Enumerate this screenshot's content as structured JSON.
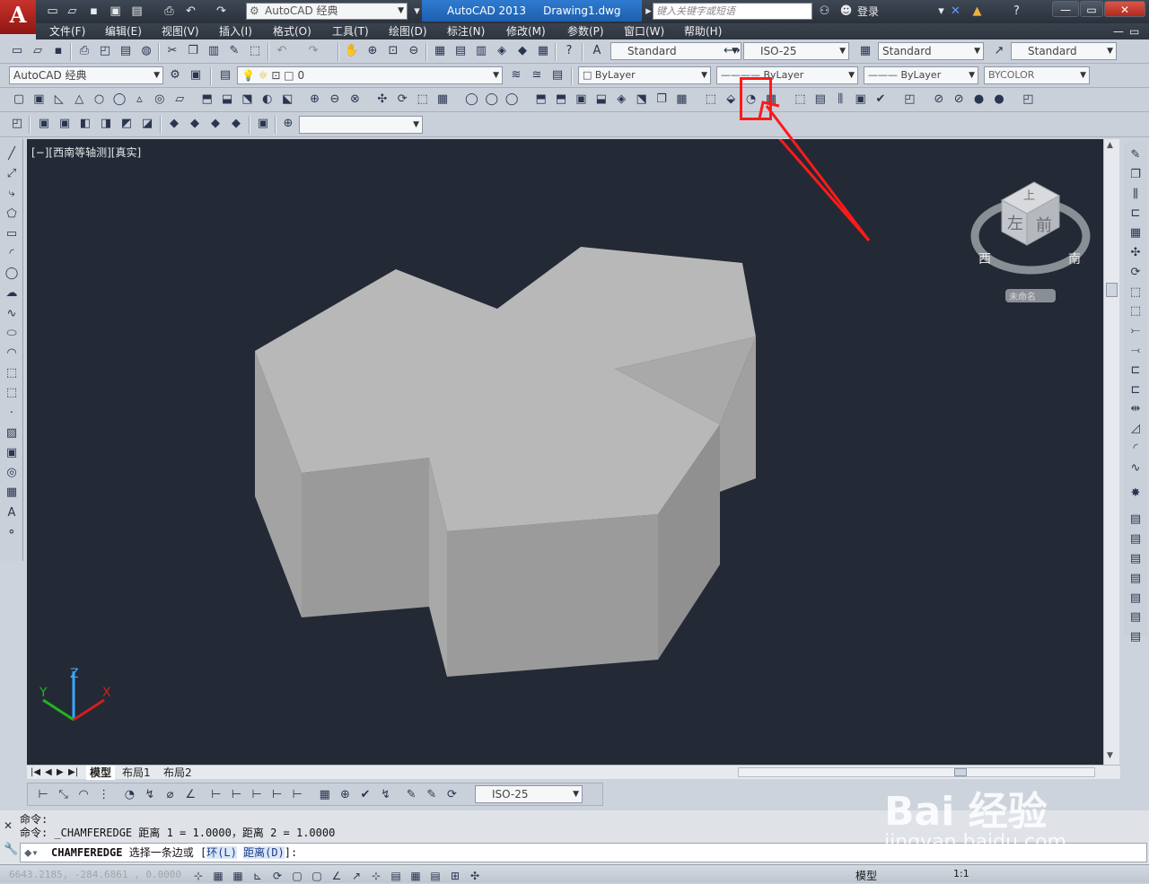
{
  "title_bar": {
    "logo": "A",
    "workspace": "AutoCAD 经典",
    "app_name": "AutoCAD 2013",
    "doc_name": "Drawing1.dwg",
    "search_placeholder": "键入关键字或短语",
    "login_label": "登录",
    "minimize": "—",
    "restore": "▭",
    "close": "✕"
  },
  "menu": [
    "文件(F)",
    "编辑(E)",
    "视图(V)",
    "插入(I)",
    "格式(O)",
    "工具(T)",
    "绘图(D)",
    "标注(N)",
    "修改(M)",
    "参数(P)",
    "窗口(W)",
    "帮助(H)"
  ],
  "styles_toolbar": {
    "text_style": "Standard",
    "dim_style": "ISO-25",
    "table_style": "Standard",
    "multileader_style": "Standard"
  },
  "workspace_combo": "AutoCAD 经典",
  "layer_combo": "0",
  "properties": {
    "color": "ByLayer",
    "linetype": "ByLayer",
    "lineweight": "ByLayer",
    "plotstyle": "BYCOLOR"
  },
  "viewport": {
    "label": "[−][西南等轴测][真实]",
    "viewcube": {
      "top": "上",
      "left": "左",
      "front": "前",
      "west": "西",
      "south": "南",
      "wcs": "未命名"
    }
  },
  "tabs": [
    "模型",
    "布局1",
    "布局2"
  ],
  "dim_toolbar": {
    "dim_style": "ISO-25"
  },
  "command": {
    "history": [
      "命令:",
      "命令: _CHAMFEREDGE 距离 1 = 1.0000，距离 2 = 1.0000"
    ],
    "prompt_cmd": "CHAMFEREDGE",
    "prompt_text": "选择一条边或",
    "opt_ring": "环(L)",
    "opt_distance": "距离(D)",
    "prompt_tail": "]:"
  },
  "status": {
    "coords": "6643.2185, -284.6861 , 0.0000",
    "model": "模型",
    "scale": "1:1"
  },
  "watermark": {
    "text": "Bai 经验",
    "url": "jingyan.baidu.com"
  },
  "colors": {
    "viewport_bg": "#232a35",
    "solid_top": "#b6b6b6",
    "highlight": "#ff0000"
  }
}
